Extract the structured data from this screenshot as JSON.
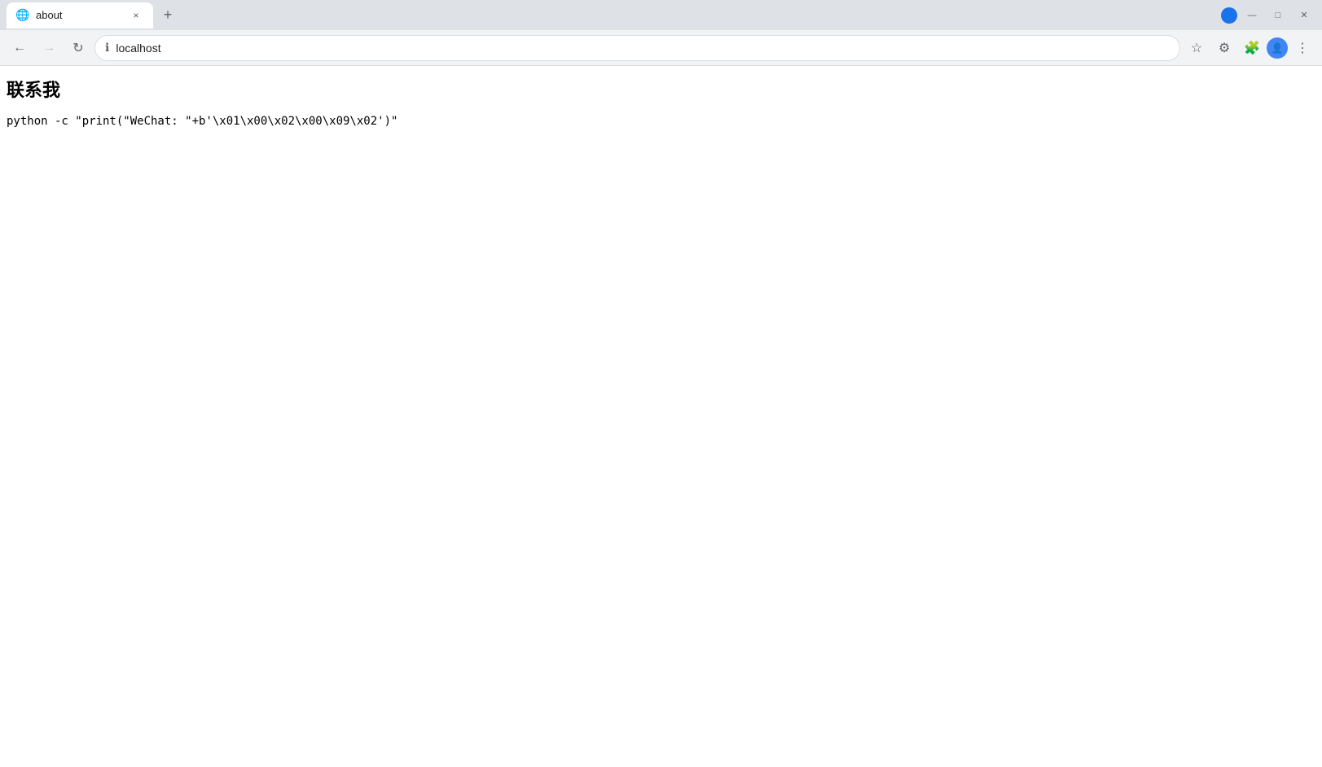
{
  "browser": {
    "tab": {
      "title": "about",
      "favicon": "🌐",
      "close_label": "×"
    },
    "new_tab_label": "+",
    "window_controls": {
      "minimize": "—",
      "maximize": "□",
      "close": "✕"
    },
    "address_bar": {
      "url": "localhost",
      "icon": "ℹ"
    },
    "toolbar_buttons": {
      "bookmark": "☆",
      "settings": "⚙",
      "extensions": "🧩",
      "profile": "👤",
      "menu": "⋮"
    }
  },
  "page": {
    "heading": "联系我",
    "code_line": "python -c \"print(\"WeChat: \"+b'\\x01\\x00\\x02\\x00\\x09\\x02')\""
  }
}
